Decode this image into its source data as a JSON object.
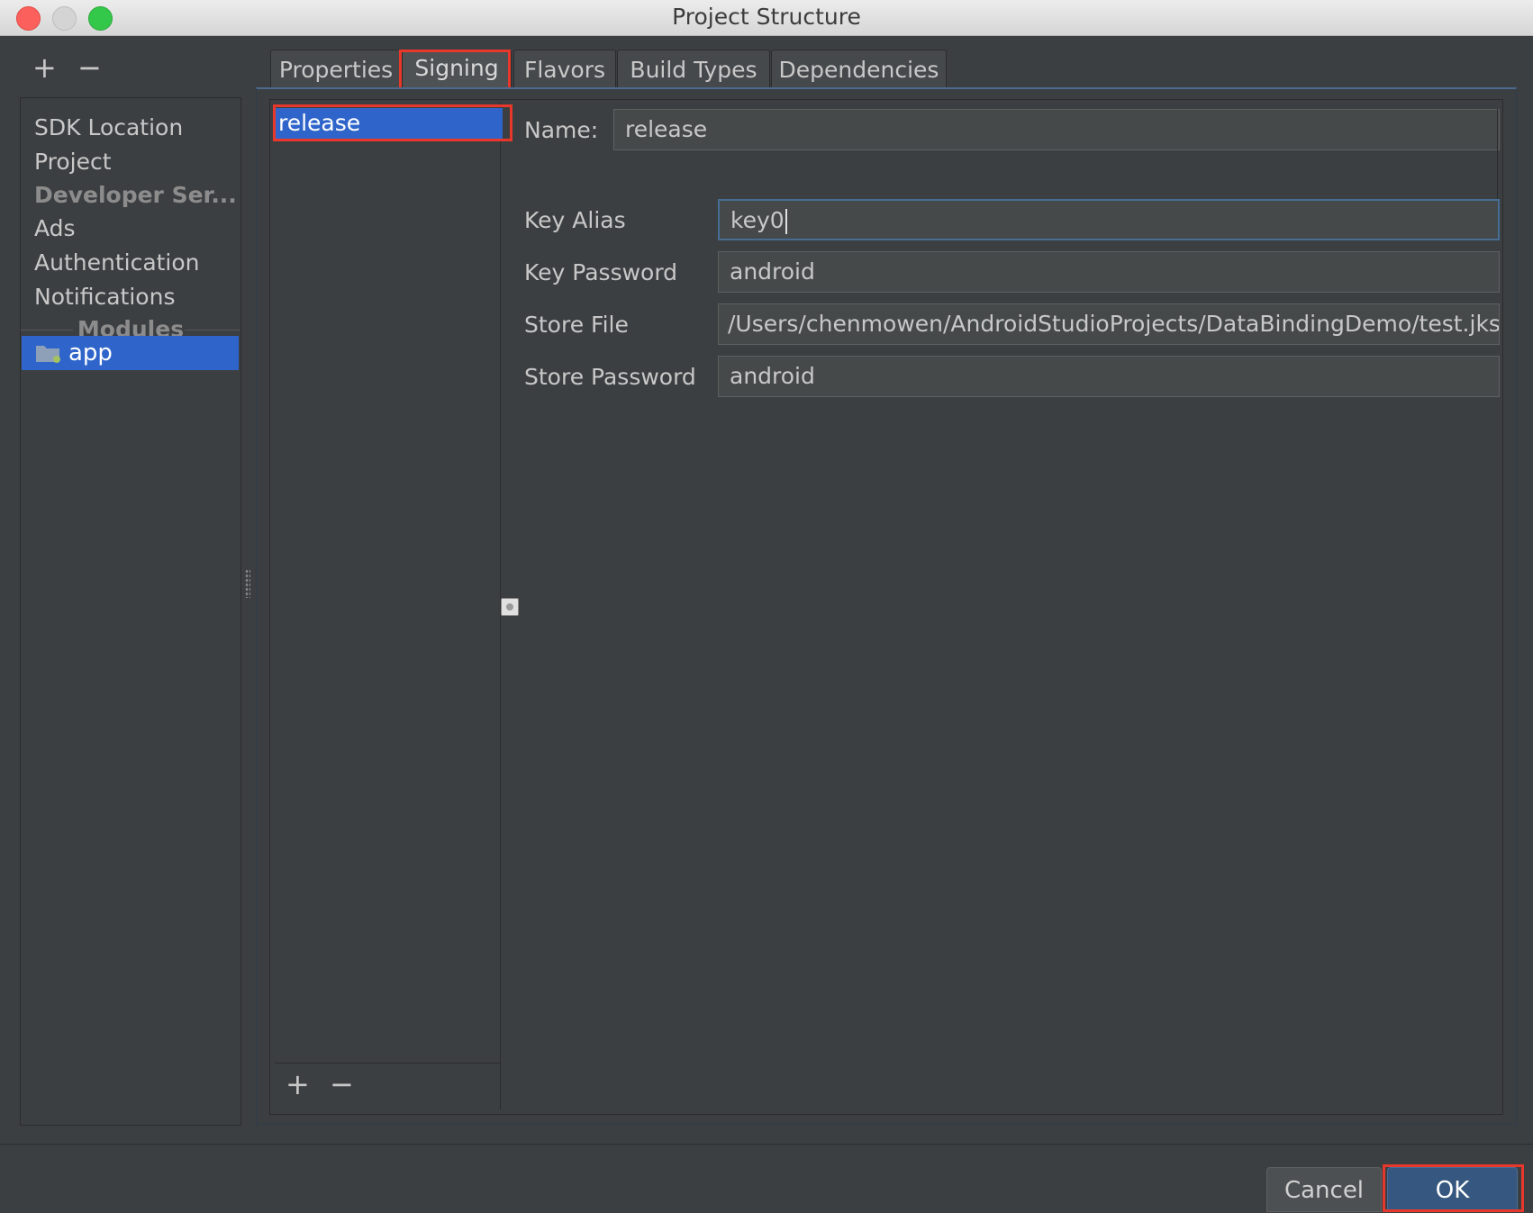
{
  "window": {
    "title": "Project Structure"
  },
  "sidebar": {
    "add_glyph": "+",
    "remove_glyph": "−",
    "items": [
      {
        "label": "SDK Location"
      },
      {
        "label": "Project"
      },
      {
        "label": "Developer Ser..."
      },
      {
        "label": "Ads"
      },
      {
        "label": "Authentication"
      },
      {
        "label": "Notifications"
      }
    ],
    "modules_header": "Modules",
    "module_app": {
      "label": "app",
      "icon": "module-folder-icon"
    }
  },
  "tabs": [
    {
      "label": "Properties"
    },
    {
      "label": "Signing",
      "selected": true
    },
    {
      "label": "Flavors"
    },
    {
      "label": "Build Types"
    },
    {
      "label": "Dependencies"
    }
  ],
  "signing_configs": {
    "items": [
      {
        "label": "release",
        "selected": true
      }
    ],
    "add_glyph": "+",
    "remove_glyph": "−"
  },
  "form": {
    "name_label": "Name:",
    "name_value": "release",
    "key_alias_label": "Key Alias",
    "key_alias_value": "key0",
    "key_password_label": "Key Password",
    "key_password_value": "android",
    "store_file_label": "Store File",
    "store_file_value": "/Users/chenmowen/AndroidStudioProjects/DataBindingDemo/test.jks",
    "store_password_label": "Store Password",
    "store_password_value": "android"
  },
  "buttons": {
    "cancel": "Cancel",
    "ok": "OK"
  },
  "colors": {
    "highlight_box": "#e8372b",
    "selection": "#2f65ca",
    "ok_button": "#365880"
  }
}
